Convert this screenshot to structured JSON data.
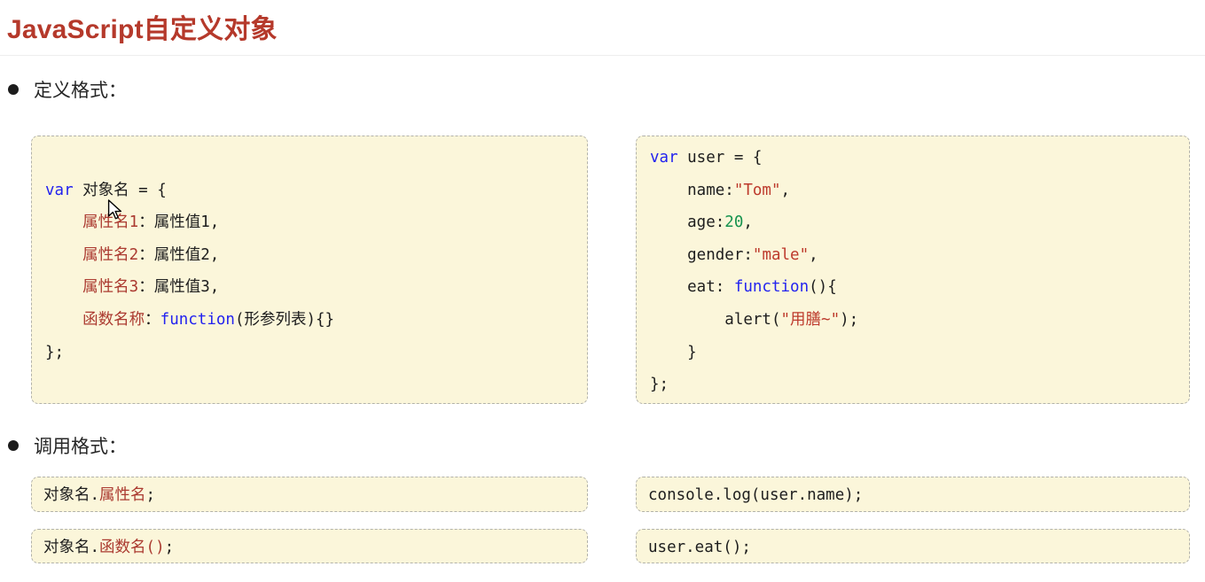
{
  "title": "JavaScript自定义对象",
  "sections": {
    "definition": {
      "label": "定义格式："
    },
    "invocation": {
      "label": "调用格式："
    }
  },
  "icons": {
    "bullet": "circle-bullet",
    "cursor": "mouse-pointer-arrow"
  },
  "colors": {
    "titleRed": "#b5392b",
    "codeDefault": "#1e1e1e",
    "keyword": "#2323ef",
    "nameRed": "#ab3a30",
    "stringRed": "#bd3a2c",
    "numberGreen": "#17934f",
    "boxBg": "#fbf6da",
    "boxBorder": "#b2b2aa"
  },
  "code": {
    "definition_template": {
      "lines": [
        [],
        [
          {
            "t": "var",
            "c": "k"
          },
          {
            "t": " 对象名 = {",
            "c": "d"
          }
        ],
        [
          {
            "t": "    ",
            "c": "d"
          },
          {
            "t": "属性名1",
            "c": "r"
          },
          {
            "t": "：属性值1,",
            "c": "d"
          }
        ],
        [
          {
            "t": "    ",
            "c": "d"
          },
          {
            "t": "属性名2",
            "c": "r"
          },
          {
            "t": "：属性值2,",
            "c": "d"
          }
        ],
        [
          {
            "t": "    ",
            "c": "d"
          },
          {
            "t": "属性名3",
            "c": "r"
          },
          {
            "t": "：属性值3,",
            "c": "d"
          }
        ],
        [
          {
            "t": "    ",
            "c": "d"
          },
          {
            "t": "函数名称",
            "c": "r"
          },
          {
            "t": "：",
            "c": "d"
          },
          {
            "t": "function",
            "c": "k"
          },
          {
            "t": "(形参列表){}",
            "c": "d"
          }
        ],
        [
          {
            "t": "};",
            "c": "d"
          }
        ]
      ]
    },
    "definition_example": {
      "lines": [
        [
          {
            "t": "var",
            "c": "k"
          },
          {
            "t": " user = {",
            "c": "d"
          }
        ],
        [
          {
            "t": "    name:",
            "c": "d"
          },
          {
            "t": "\"Tom\"",
            "c": "s"
          },
          {
            "t": ",",
            "c": "d"
          }
        ],
        [
          {
            "t": "    age:",
            "c": "d"
          },
          {
            "t": "20",
            "c": "n"
          },
          {
            "t": ",",
            "c": "d"
          }
        ],
        [
          {
            "t": "    gender:",
            "c": "d"
          },
          {
            "t": "\"male\"",
            "c": "s"
          },
          {
            "t": ",",
            "c": "d"
          }
        ],
        [
          {
            "t": "    eat: ",
            "c": "d"
          },
          {
            "t": "function",
            "c": "k"
          },
          {
            "t": "(){",
            "c": "d"
          }
        ],
        [
          {
            "t": "        alert(",
            "c": "d"
          },
          {
            "t": "\"用膳~\"",
            "c": "s"
          },
          {
            "t": ");",
            "c": "d"
          }
        ],
        [
          {
            "t": "    }",
            "c": "d"
          }
        ],
        [
          {
            "t": "};",
            "c": "d"
          }
        ]
      ]
    },
    "invoke_property_template": {
      "lines": [
        [
          {
            "t": "对象名.",
            "c": "d"
          },
          {
            "t": "属性名",
            "c": "r"
          },
          {
            "t": ";",
            "c": "d"
          }
        ]
      ]
    },
    "invoke_method_template": {
      "lines": [
        [
          {
            "t": "对象名.",
            "c": "d"
          },
          {
            "t": "函数名()",
            "c": "r"
          },
          {
            "t": ";",
            "c": "d"
          }
        ]
      ]
    },
    "invoke_property_example": {
      "lines": [
        [
          {
            "t": "console.log(user.name);",
            "c": "d"
          }
        ]
      ]
    },
    "invoke_method_example": {
      "lines": [
        [
          {
            "t": "user.eat();",
            "c": "d"
          }
        ]
      ]
    }
  }
}
